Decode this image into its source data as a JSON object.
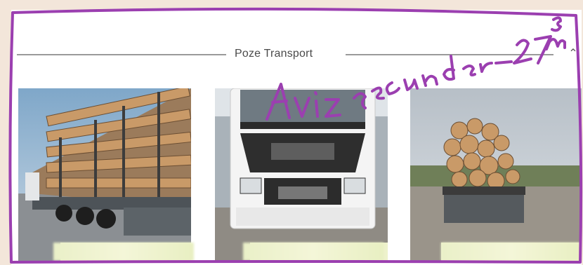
{
  "section": {
    "title": "Poze Transport",
    "collapse_icon": "chevron-up-icon"
  },
  "photos": [
    {
      "name": "photo-truck-trailer-logs",
      "blurred": true
    },
    {
      "name": "photo-truck-front",
      "blurred": true
    },
    {
      "name": "photo-trailer-rear-logs",
      "blurred": true
    }
  ],
  "annotation": {
    "text": "Aviz secundar - 27 m³",
    "color": "#9b3fb0"
  }
}
